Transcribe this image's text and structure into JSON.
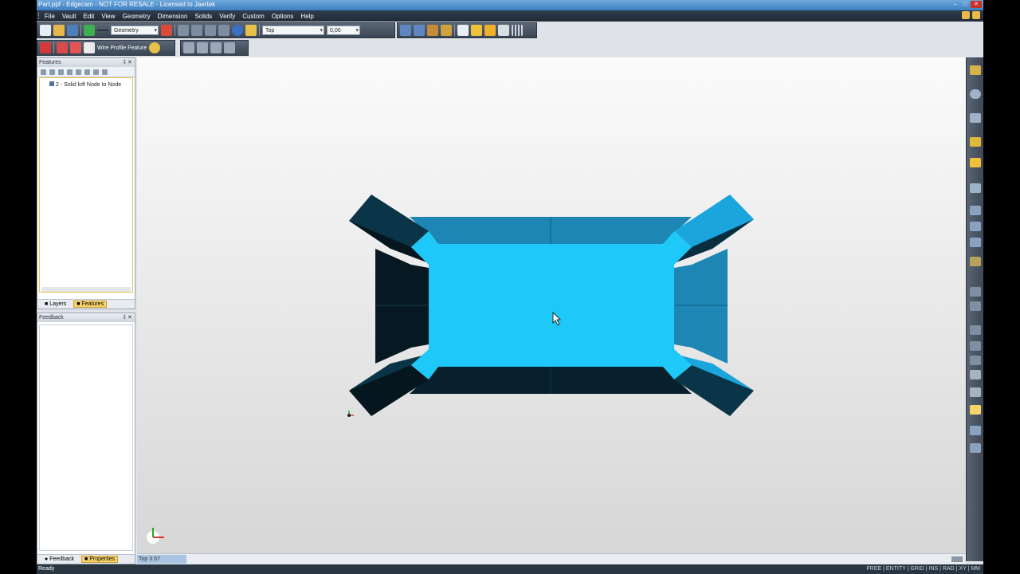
{
  "window": {
    "title": "Part.ppf - Edgecam - NOT FOR RESALE - Licensed to Jaertek"
  },
  "menu": {
    "items": [
      "File",
      "Vault",
      "Edit",
      "View",
      "Geometry",
      "Dimension",
      "Solids",
      "Verify",
      "Custom",
      "Options",
      "Help"
    ]
  },
  "toolbar": {
    "geometry_combo": "Geometry",
    "view_combo": "Top",
    "value_combo": "0,00",
    "wire_profile_label": "Wire Profile Feature"
  },
  "features_panel": {
    "title": "Features",
    "tree_item": "2 - Solid loft Node to Node",
    "tabs": {
      "layers": "Layers",
      "features": "Features"
    }
  },
  "feedback_panel": {
    "title": "Feedback",
    "tabs": {
      "feedback": "Feedback",
      "properties": "Properties"
    }
  },
  "viewport": {
    "view_label": "Top 3.57"
  },
  "status": {
    "left": "Ready",
    "right": "FREE | ENTITY | GRID | INS | RAD | XY | MM"
  },
  "colors": {
    "face_top": "#1ec8f8",
    "face_dark": "#08222f",
    "face_mid": "#1e86b4",
    "face_light": "#1aa6dc"
  }
}
